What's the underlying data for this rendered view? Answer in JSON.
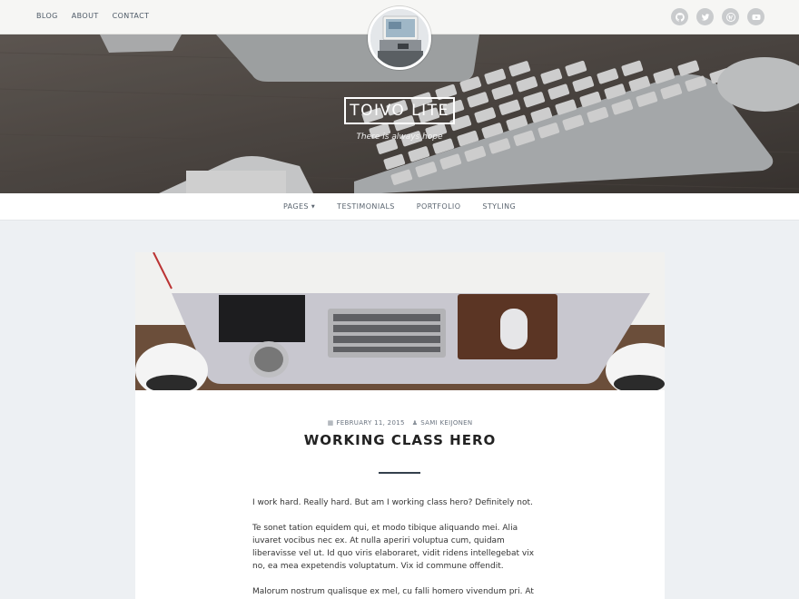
{
  "topbar": {
    "nav": [
      "BLOG",
      "ABOUT",
      "CONTACT"
    ],
    "social_icons": [
      "github-icon",
      "twitter-icon",
      "wordpress-icon",
      "youtube-icon"
    ]
  },
  "site": {
    "title": "TOIVO LITE",
    "tagline": "There is always hope"
  },
  "main_nav": {
    "items": [
      {
        "label": "PAGES",
        "has_dropdown": true
      },
      {
        "label": "TESTIMONIALS",
        "has_dropdown": false
      },
      {
        "label": "PORTFOLIO",
        "has_dropdown": false
      },
      {
        "label": "STYLING",
        "has_dropdown": false
      }
    ]
  },
  "post": {
    "date": "FEBRUARY 11, 2015",
    "author": "SAMI KEIJONEN",
    "title": "WORKING CLASS HERO",
    "paragraphs": [
      "I work hard. Really hard. But am I working class hero? Definitely not.",
      "Te sonet tation equidem qui, et modo tibique aliquando mei. Alia iuvaret vocibus nec ex. At nulla aperiri voluptua cum, quidam liberavisse vel ut. Id quo viris elaboraret, vidit ridens intellegebat vix no, ea mea expetendis voluptatum. Vix id commune offendit.",
      "Malorum nostrum qualisque ex mel, cu falli homero vivendum pri. At clita"
    ]
  },
  "colors": {
    "page_bg": "#edf0f3",
    "topbar_bg": "#f6f6f4",
    "divider": "#34404c"
  }
}
